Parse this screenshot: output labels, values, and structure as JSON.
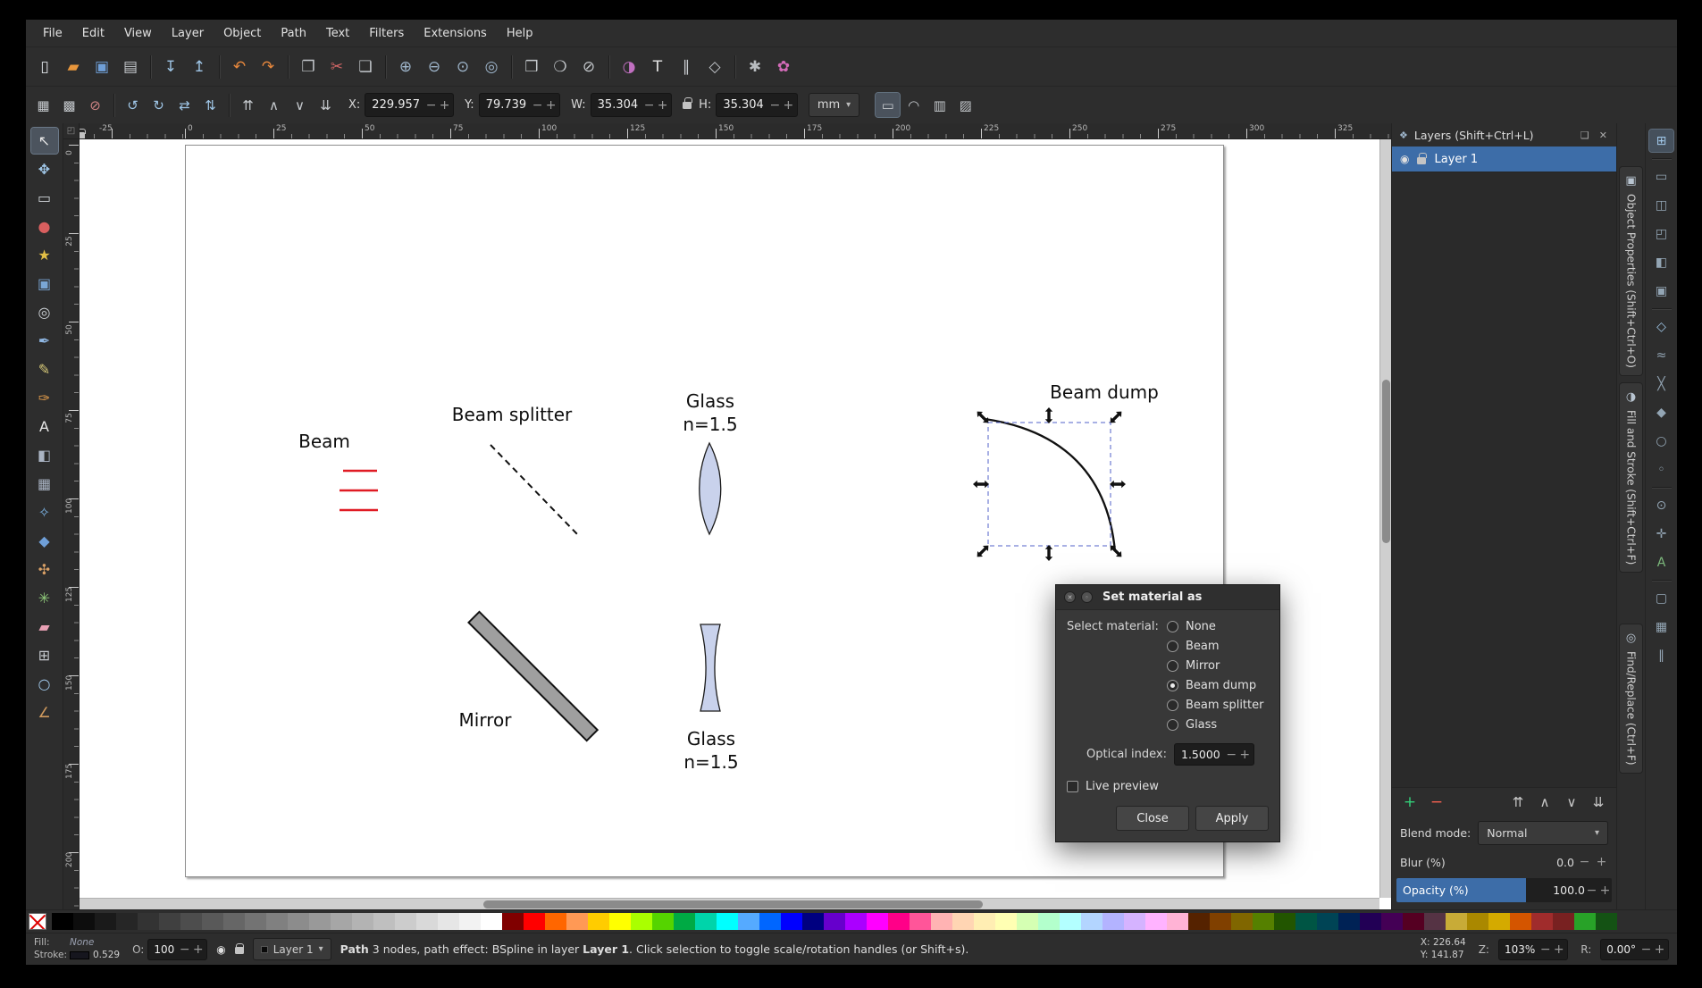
{
  "ui": {
    "minus": "−",
    "plus": "+",
    "caret": "▾",
    "close_x": "✕",
    "undock": "❑",
    "panel_icon": "❖",
    "eye": "◉",
    "plus_big": "+",
    "raise_top": "⇈",
    "raise": "∧",
    "lower": "∨",
    "lower_bottom": "⇊",
    "circle_a": "✕",
    "circle_b": "◦"
  },
  "menu": {
    "items": [
      "File",
      "Edit",
      "View",
      "Layer",
      "Object",
      "Path",
      "Text",
      "Filters",
      "Extensions",
      "Help"
    ]
  },
  "command_toolbar": {
    "items": [
      {
        "name": "new-document",
        "glyph": "▯",
        "color": "#dde1e5"
      },
      {
        "name": "open-document",
        "glyph": "▰",
        "color": "#e8963c"
      },
      {
        "name": "save-document",
        "glyph": "▣",
        "color": "#6f9fd8"
      },
      {
        "name": "print-document",
        "glyph": "▤",
        "color": "#c3c7cb"
      },
      {
        "sep": true
      },
      {
        "name": "import",
        "glyph": "↧",
        "color": "#9fc6e7"
      },
      {
        "name": "export",
        "glyph": "↥",
        "color": "#9fc6e7"
      },
      {
        "sep": true
      },
      {
        "name": "undo",
        "glyph": "↶",
        "color": "#e8883d"
      },
      {
        "name": "redo",
        "glyph": "↷",
        "color": "#e8883d"
      },
      {
        "sep": true
      },
      {
        "name": "copy",
        "glyph": "❐",
        "color": "#c3c7cb"
      },
      {
        "name": "cut",
        "glyph": "✂",
        "color": "#d06565"
      },
      {
        "name": "paste",
        "glyph": "❏",
        "color": "#c3c7cb"
      },
      {
        "sep": true
      },
      {
        "name": "zoom-in",
        "glyph": "⊕",
        "color": "#9fb6cc"
      },
      {
        "name": "zoom-out",
        "glyph": "⊖",
        "color": "#9fb6cc"
      },
      {
        "name": "zoom-1-1",
        "glyph": "⊙",
        "color": "#9fb6cc"
      },
      {
        "name": "zoom-page",
        "glyph": "◎",
        "color": "#9fb6cc"
      },
      {
        "sep": true
      },
      {
        "name": "duplicate",
        "glyph": "❒",
        "color": "#c3c7cb"
      },
      {
        "name": "create-clone",
        "glyph": "❍",
        "color": "#c3c7cb"
      },
      {
        "name": "unlink-clone",
        "glyph": "⊘",
        "color": "#c3c7cb"
      },
      {
        "sep": true
      },
      {
        "name": "fill-stroke-dialog",
        "glyph": "◑",
        "color": "#c06fc0"
      },
      {
        "name": "text-dialog",
        "glyph": "T",
        "color": "#e6e6e6"
      },
      {
        "name": "align-distribute-dialog",
        "glyph": "∥",
        "color": "#c3c7cb"
      },
      {
        "name": "xml-editor",
        "glyph": "◇",
        "color": "#c3c7cb"
      },
      {
        "sep": true
      },
      {
        "name": "preferences",
        "glyph": "✱",
        "color": "#b8bcc0"
      },
      {
        "name": "color-gradient",
        "glyph": "✿",
        "color": "#d36bb8"
      }
    ]
  },
  "tool_controls": {
    "left_icons": [
      {
        "name": "select-all",
        "glyph": "▦",
        "color": "#c3c7cb"
      },
      {
        "name": "select-all-layers",
        "glyph": "▩",
        "color": "#c3c7cb"
      },
      {
        "name": "deselect",
        "glyph": "⊘",
        "color": "#cf8484"
      },
      {
        "sep": true
      },
      {
        "name": "rotate-90-ccw",
        "glyph": "↺",
        "color": "#9fc6e7"
      },
      {
        "name": "rotate-90-cw",
        "glyph": "↻",
        "color": "#9fc6e7"
      },
      {
        "name": "flip-horizontal",
        "glyph": "⇄",
        "color": "#9fc6e7"
      },
      {
        "name": "flip-vertical",
        "glyph": "⇅",
        "color": "#9fc6e7"
      },
      {
        "sep": true
      },
      {
        "name": "raise-to-top",
        "glyph": "⇈",
        "color": "#c3c7cb"
      },
      {
        "name": "raise",
        "glyph": "∧",
        "color": "#c3c7cb"
      },
      {
        "name": "lower",
        "glyph": "∨",
        "color": "#c3c7cb"
      },
      {
        "name": "lower-to-bottom",
        "glyph": "⇊",
        "color": "#c3c7cb"
      }
    ],
    "x_label": "X:",
    "x_value": "229.957",
    "y_label": "Y:",
    "y_value": "79.739",
    "w_label": "W:",
    "w_value": "35.304",
    "h_label": "H:",
    "h_value": "35.304",
    "units": "mm",
    "right_toggles": [
      {
        "name": "scale-stroke-toggle",
        "glyph": "▭",
        "color": "#c3c7cb",
        "pressed": true
      },
      {
        "name": "scale-corners-toggle",
        "glyph": "◠",
        "color": "#c3c7cb"
      },
      {
        "name": "scale-gradients-toggle",
        "glyph": "▥",
        "color": "#c3c7cb"
      },
      {
        "name": "scale-patterns-toggle",
        "glyph": "▨",
        "color": "#c3c7cb"
      }
    ]
  },
  "toolbox": {
    "tools": [
      {
        "name": "selector-tool",
        "glyph": "↖",
        "color": "#e8e8e8",
        "active": true
      },
      {
        "name": "node-tool",
        "glyph": "✥",
        "color": "#9fc6e7"
      },
      {
        "name": "rectangle-tool",
        "glyph": "▭",
        "color": "#cdd2d6"
      },
      {
        "name": "ellipse-tool",
        "glyph": "●",
        "color": "#d95f5f"
      },
      {
        "name": "star-tool",
        "glyph": "★",
        "color": "#e3bf45"
      },
      {
        "name": "box-3d-tool",
        "glyph": "▣",
        "color": "#7aa7d6"
      },
      {
        "name": "spiral-tool",
        "glyph": "◎",
        "color": "#cdd2d6"
      },
      {
        "name": "pen-tool",
        "glyph": "✒",
        "color": "#8fb7e3"
      },
      {
        "name": "pencil-tool",
        "glyph": "✎",
        "color": "#d6c878"
      },
      {
        "name": "calligraphy-tool",
        "glyph": "✑",
        "color": "#df9a4a"
      },
      {
        "name": "text-tool",
        "glyph": "A",
        "color": "#e8e8e8"
      },
      {
        "name": "gradient-tool",
        "glyph": "◧",
        "color": "#aab4c4"
      },
      {
        "name": "mesh-tool",
        "glyph": "▦",
        "color": "#aab4c4"
      },
      {
        "name": "dropper-tool",
        "glyph": "✧",
        "color": "#7ab0e0"
      },
      {
        "name": "paint-bucket-tool",
        "glyph": "◆",
        "color": "#6f9fd8"
      },
      {
        "name": "tweak-tool",
        "glyph": "✣",
        "color": "#d9a066"
      },
      {
        "name": "spray-tool",
        "glyph": "✳",
        "color": "#8fc97a"
      },
      {
        "name": "eraser-tool",
        "glyph": "▰",
        "color": "#e8a0b4"
      },
      {
        "name": "connector-tool",
        "glyph": "⊞",
        "color": "#c4c8cc"
      },
      {
        "name": "zoom-tool",
        "glyph": "○",
        "color": "#9fc6e7"
      },
      {
        "name": "measure-tool",
        "glyph": "∠",
        "color": "#cf9a5e"
      }
    ]
  },
  "rulers": {
    "h_labels": [
      "-25",
      "0",
      "25",
      "50",
      "75",
      "100",
      "125",
      "150",
      "175",
      "200",
      "225",
      "250",
      "275",
      "300",
      "325"
    ],
    "v_labels": [
      "0",
      "25",
      "50",
      "75",
      "100",
      "125",
      "150",
      "175",
      "200"
    ]
  },
  "canvas": {
    "labels": {
      "beam": "Beam",
      "beam_splitter": "Beam splitter",
      "glass_top_line1": "Glass",
      "glass_top_line2": "n=1.5",
      "beam_dump": "Beam dump",
      "mirror": "Mirror",
      "glass_bottom_line1": "Glass",
      "glass_bottom_line2": "n=1.5"
    },
    "colors": {
      "beam_red": "#e01b24",
      "glass_fill": "#c9d2ec",
      "glass_stroke": "#1a1a1a",
      "mirror_fill": "#9f9f9f",
      "mirror_stroke": "#111111",
      "path_black": "#111111",
      "selection_dash": "#5060c8"
    }
  },
  "dialog": {
    "title": "Set material as",
    "select_label": "Select material:",
    "options": [
      {
        "label": "None",
        "selected": false
      },
      {
        "label": "Beam",
        "selected": false
      },
      {
        "label": "Mirror",
        "selected": false
      },
      {
        "label": "Beam dump",
        "selected": true
      },
      {
        "label": "Beam splitter",
        "selected": false
      },
      {
        "label": "Glass",
        "selected": false
      }
    ],
    "optical_index_label": "Optical index:",
    "optical_index_value": "1.5000",
    "live_preview_label": "Live preview",
    "close_label": "Close",
    "apply_label": "Apply"
  },
  "layers_panel": {
    "title": "Layers (Shift+Ctrl+L)",
    "layer_name": "Layer 1",
    "blend_mode_label": "Blend mode:",
    "blend_mode_value": "Normal",
    "blur_label": "Blur (%)",
    "blur_value": "0.0",
    "opacity_label": "Opacity (%)",
    "opacity_value": "100.0",
    "accent": "#3d6da8"
  },
  "side_tabs": [
    {
      "name": "object-properties",
      "icon": "▣",
      "label": "Object Properties (Shift+Ctrl+O)"
    },
    {
      "name": "fill-and-stroke",
      "icon": "◑",
      "label": "Fill and Stroke (Shift+Ctrl+F)"
    },
    {
      "name": "find-replace",
      "icon": "◎",
      "label": "Find/Replace (Ctrl+F)"
    }
  ],
  "snap_toolbar": {
    "icons": [
      {
        "name": "snap-enabled",
        "glyph": "⊞",
        "color": "#9fc6e7",
        "pressed": true
      },
      {
        "sep": true
      },
      {
        "name": "snap-bbox",
        "glyph": "▭",
        "color": "#93a5b4"
      },
      {
        "name": "snap-bbox-edges",
        "glyph": "◫",
        "color": "#93a5b4"
      },
      {
        "name": "snap-bbox-corners",
        "glyph": "◰",
        "color": "#93a5b4"
      },
      {
        "name": "snap-bbox-edge-midpoints",
        "glyph": "◧",
        "color": "#93a5b4"
      },
      {
        "name": "snap-bbox-centers",
        "glyph": "▣",
        "color": "#93a5b4"
      },
      {
        "sep": true
      },
      {
        "name": "snap-nodes",
        "glyph": "◇",
        "color": "#9fc6e7"
      },
      {
        "name": "snap-paths",
        "glyph": "≈",
        "color": "#93a5b4"
      },
      {
        "name": "snap-path-intersections",
        "glyph": "╳",
        "color": "#93a5b4"
      },
      {
        "name": "snap-cusp-nodes",
        "glyph": "◆",
        "color": "#93a5b4"
      },
      {
        "name": "snap-smooth-nodes",
        "glyph": "○",
        "color": "#93a5b4"
      },
      {
        "name": "snap-line-midpoints",
        "glyph": "◦",
        "color": "#93a5b4"
      },
      {
        "sep": true
      },
      {
        "name": "snap-object-centers",
        "glyph": "⊙",
        "color": "#93a5b4"
      },
      {
        "name": "snap-rotation-centers",
        "glyph": "✛",
        "color": "#93a5b4"
      },
      {
        "name": "snap-text-baseline",
        "glyph": "A",
        "color": "#7cb87c"
      },
      {
        "sep": true
      },
      {
        "name": "snap-page-border",
        "glyph": "▢",
        "color": "#93a5b4"
      },
      {
        "name": "snap-grid",
        "glyph": "▦",
        "color": "#93a5b4"
      },
      {
        "name": "snap-guides",
        "glyph": "∥",
        "color": "#93a5b4"
      }
    ]
  },
  "palette": {
    "colors": [
      "#000000",
      "#0d0d0d",
      "#1a1a1a",
      "#262626",
      "#333333",
      "#404040",
      "#4d4d4d",
      "#595959",
      "#666666",
      "#737373",
      "#808080",
      "#8c8c8c",
      "#999999",
      "#a6a6a6",
      "#b3b3b3",
      "#bfbfbf",
      "#cccccc",
      "#d9d9d9",
      "#e6e6e6",
      "#f2f2f2",
      "#ffffff",
      "#800000",
      "#ff0000",
      "#ff6600",
      "#ff9955",
      "#ffcc00",
      "#ffff00",
      "#aaff00",
      "#55d400",
      "#00aa44",
      "#00d4aa",
      "#00ffff",
      "#55aaff",
      "#0066ff",
      "#0000ff",
      "#000080",
      "#6600cc",
      "#aa00ff",
      "#ff00ff",
      "#ff0088",
      "#ff5599",
      "#ffb3b3",
      "#ffd5b3",
      "#ffeeb3",
      "#ffffb3",
      "#d5ffb3",
      "#b3ffcc",
      "#b3ffff",
      "#b3d5ff",
      "#b3b3ff",
      "#d5b3ff",
      "#ffb3ff",
      "#ffb3d5",
      "#552200",
      "#804000",
      "#806600",
      "#558000",
      "#225500",
      "#005544",
      "#004455",
      "#002255",
      "#220055",
      "#440055",
      "#550022",
      "#553344",
      "#c8ab37",
      "#aa8800",
      "#d4aa00",
      "#d45500",
      "#a02c2c",
      "#782121",
      "#28a228",
      "#145214"
    ]
  },
  "status_bar": {
    "fill_label": "Fill:",
    "fill_value": "None",
    "stroke_label": "Stroke:",
    "stroke_value": "0.529",
    "o_label": "O:",
    "o_value": "100",
    "layer_name": "Layer 1",
    "msg_bold1": "Path",
    "msg_mid": " 3 nodes, path effect: BSpline in layer ",
    "msg_bold2": "Layer 1",
    "msg_tail": ". Click selection to toggle scale/rotation handles (or Shift+s).",
    "x_label": "X:",
    "x_value": "226.64",
    "y_label": "Y:",
    "y_value": "141.87",
    "z_label": "Z:",
    "z_value": "103%",
    "r_label": "R:",
    "r_value": "0.00°"
  }
}
